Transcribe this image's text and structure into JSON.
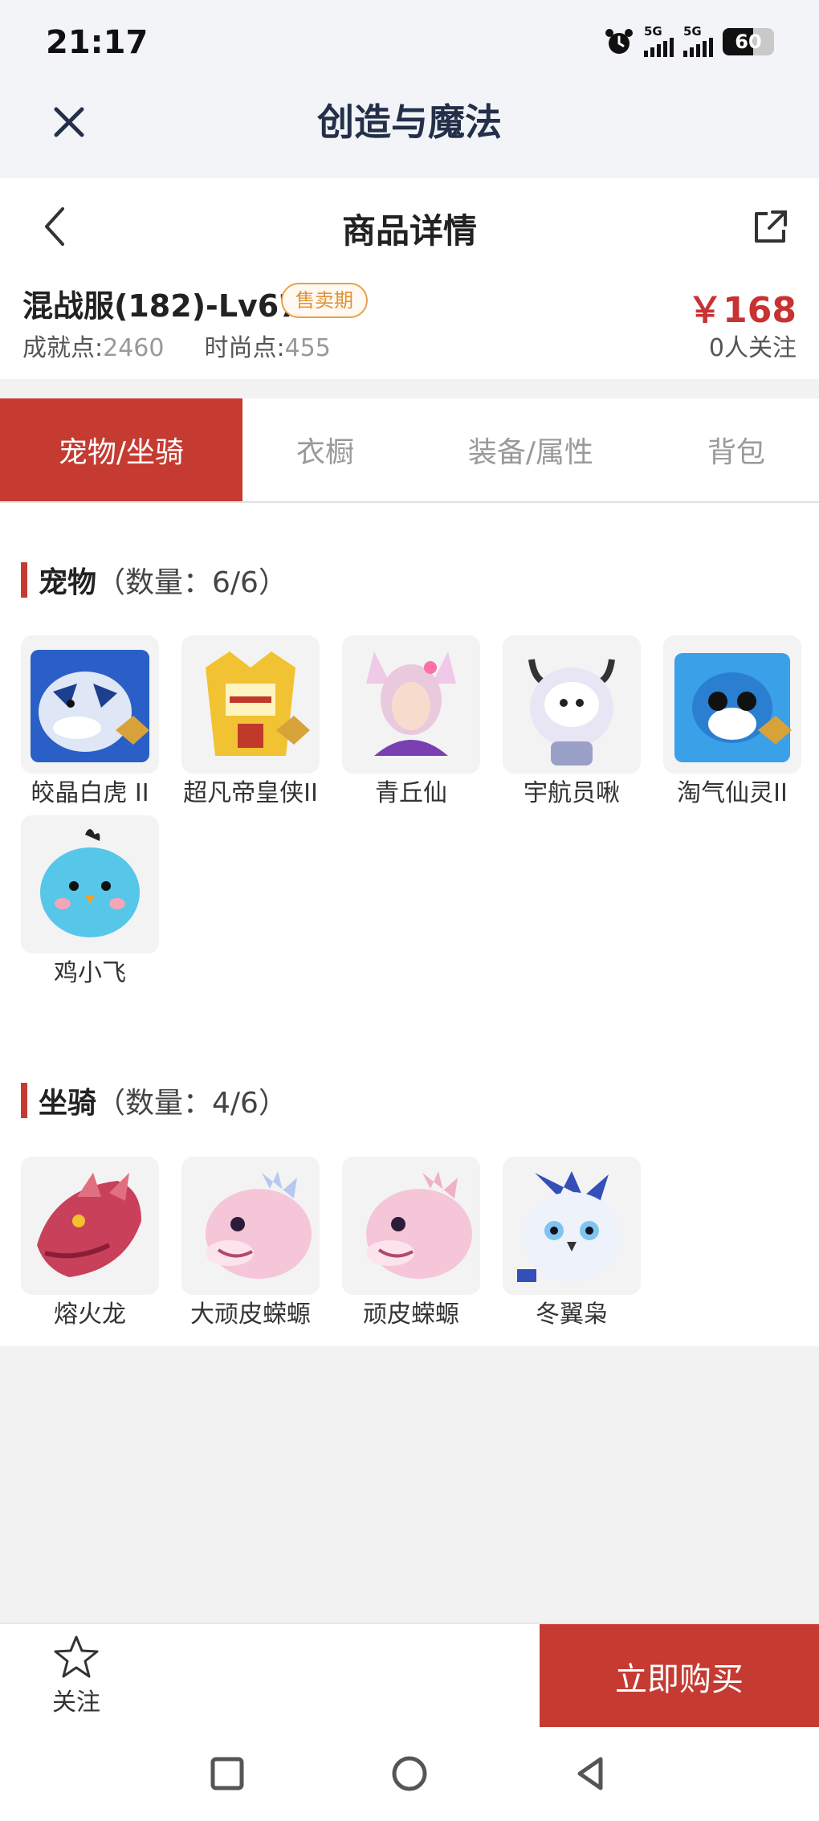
{
  "status_bar": {
    "time": "21:17",
    "signal1_label": "5G",
    "signal2_label": "5G",
    "battery": "60",
    "battery_level": 0.6
  },
  "app_bar": {
    "title": "创造与魔法",
    "close_icon": "close-icon"
  },
  "detail": {
    "page_title": "商品详情",
    "product_name": "混战服(182)-Lv67",
    "badge": "售卖期",
    "price": "￥168",
    "achievement_label": "成就点:",
    "achievement_value": "2460",
    "fashion_label": "时尚点:",
    "fashion_value": "455",
    "followers": "0人关注"
  },
  "tabs": [
    {
      "label": "宠物/坐骑",
      "active": true
    },
    {
      "label": "衣橱",
      "active": false
    },
    {
      "label": "装备/属性",
      "active": false
    },
    {
      "label": "背包",
      "active": false
    }
  ],
  "pets": {
    "title": "宠物",
    "count": "（数量：6/6）",
    "items": [
      {
        "name": "皎晶白虎 II",
        "icon": "white-tiger-icon"
      },
      {
        "name": "超凡帝皇侠II",
        "icon": "golden-hero-icon"
      },
      {
        "name": "青丘仙",
        "icon": "fox-fairy-icon"
      },
      {
        "name": "宇航员啾",
        "icon": "astronaut-icon"
      },
      {
        "name": "淘气仙灵II",
        "icon": "blue-dog-icon"
      },
      {
        "name": "鸡小飞",
        "icon": "blue-chick-icon"
      }
    ]
  },
  "mounts": {
    "title": "坐骑",
    "count": "（数量：4/6）",
    "items": [
      {
        "name": "熔火龙",
        "icon": "fire-dragon-icon"
      },
      {
        "name": "大顽皮蝾螈",
        "icon": "pink-axolotl-icon"
      },
      {
        "name": "顽皮蝾螈",
        "icon": "pink-axolotl-icon"
      },
      {
        "name": "冬翼枭",
        "icon": "winter-owl-icon"
      }
    ]
  },
  "bottom_bar": {
    "follow_label": "关注",
    "buy_label": "立即购买"
  },
  "colors": {
    "accent": "#c53b32",
    "badge": "#e39236",
    "title_navy": "#243049"
  }
}
